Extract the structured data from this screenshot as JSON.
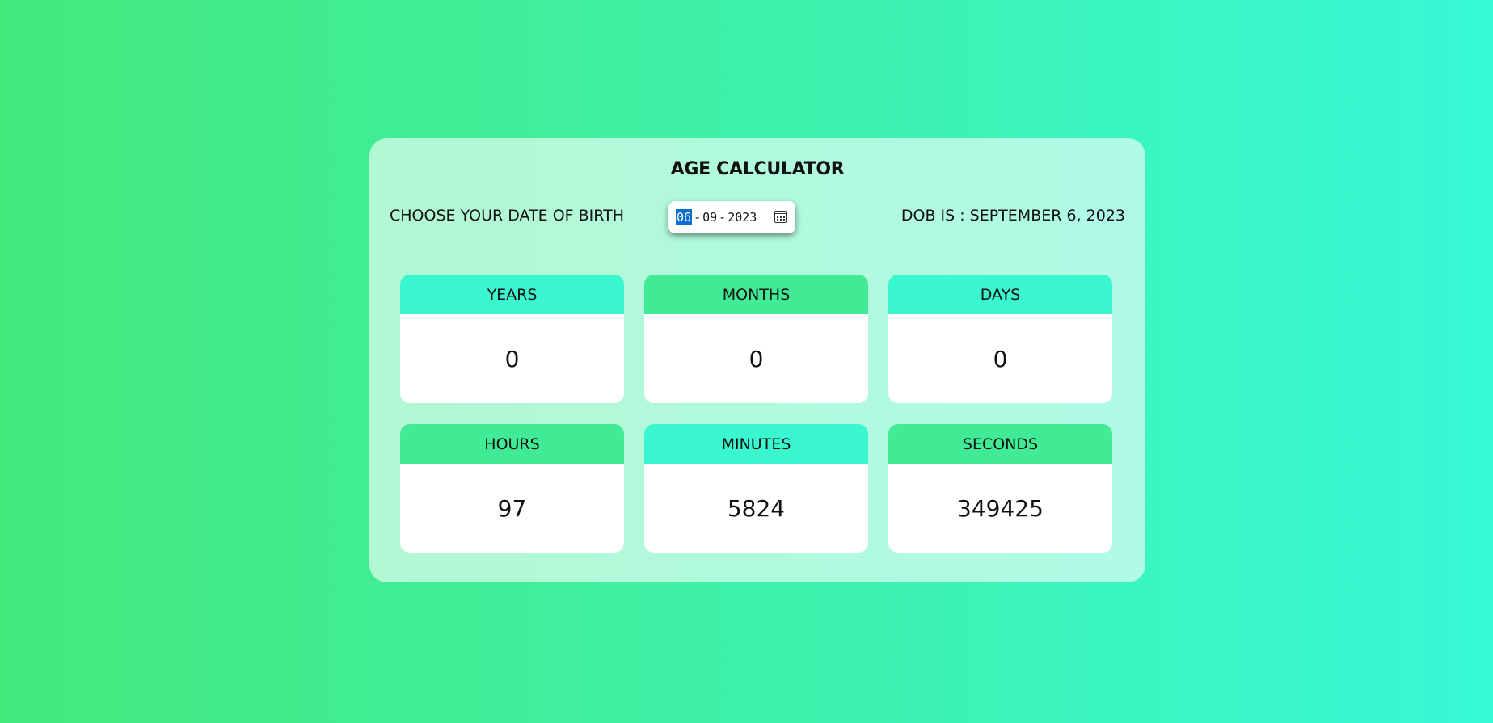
{
  "title": "AGE CALCULATOR",
  "dob": {
    "label": "CHOOSE YOUR DATE OF BIRTH",
    "input": {
      "day": "06",
      "month": "09",
      "year": "2023",
      "separator": "-"
    },
    "result": "DOB IS : SEPTEMBER 6, 2023"
  },
  "colors": {
    "background_start": "#43e97b",
    "background_end": "#38f9d7",
    "header_teal": "#3af7cf",
    "header_green": "#41eb96",
    "selection": "#0a6ed1"
  },
  "stats": [
    {
      "label": "YEARS",
      "value": "0"
    },
    {
      "label": "MONTHS",
      "value": "0"
    },
    {
      "label": "DAYS",
      "value": "0"
    },
    {
      "label": "HOURS",
      "value": "97"
    },
    {
      "label": "MINUTES",
      "value": "5824"
    },
    {
      "label": "SECONDS",
      "value": "349425"
    }
  ]
}
